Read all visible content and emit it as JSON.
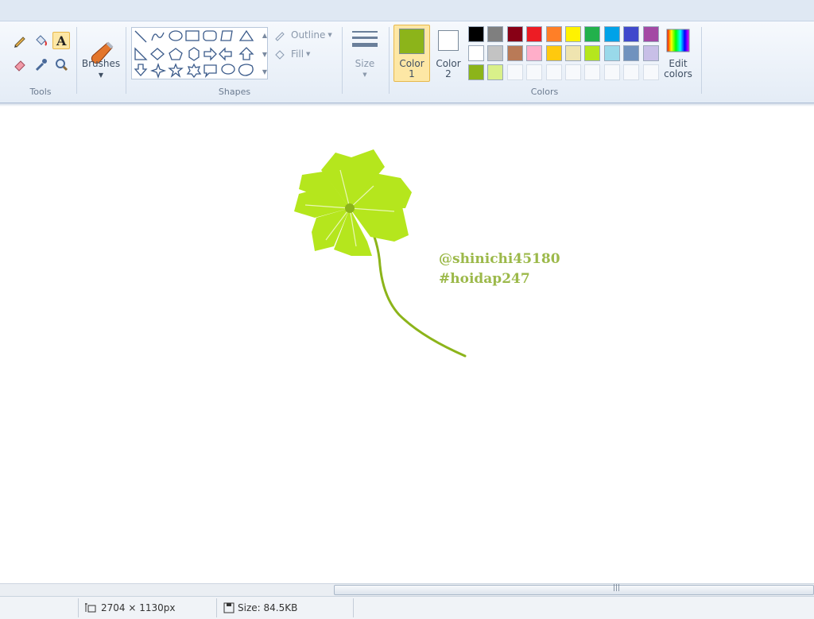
{
  "ribbon": {
    "groups": {
      "tools": "Tools",
      "shapes": "Shapes",
      "colors": "Colors"
    },
    "brushes_label": "Brushes",
    "outline_label": "Outline",
    "fill_label": "Fill",
    "size_label": "Size",
    "color1_label": "Color\n1",
    "color2_label": "Color\n2",
    "edit_colors_label": "Edit\ncolors",
    "active_tool": "text-tool"
  },
  "palette": {
    "color1": "#8cb41a",
    "color2": "#ffffff",
    "row1": [
      "#000000",
      "#7f7f7f",
      "#880015",
      "#ed1c24",
      "#ff7f27",
      "#fff200",
      "#22b14c",
      "#00a2e8",
      "#3f48cc",
      "#a349a4"
    ],
    "row2": [
      "#ffffff",
      "#c3c3c3",
      "#b97a57",
      "#ffaec9",
      "#ffc90e",
      "#efe4b0",
      "#b5e61d",
      "#99d9ea",
      "#7092be",
      "#c8bfe7"
    ],
    "row3": [
      "#8cb41a",
      "#d9f08a",
      "",
      "",
      "",
      "",
      "",
      "",
      "",
      ""
    ]
  },
  "canvas": {
    "watermark_line1": "@shinichi45180",
    "watermark_line2": "#hoidap247",
    "drawing_color": "#b5e61d",
    "stem_color": "#8cb41a"
  },
  "status": {
    "dimensions": "2704 × 1130px",
    "size": "Size: 84.5KB"
  }
}
